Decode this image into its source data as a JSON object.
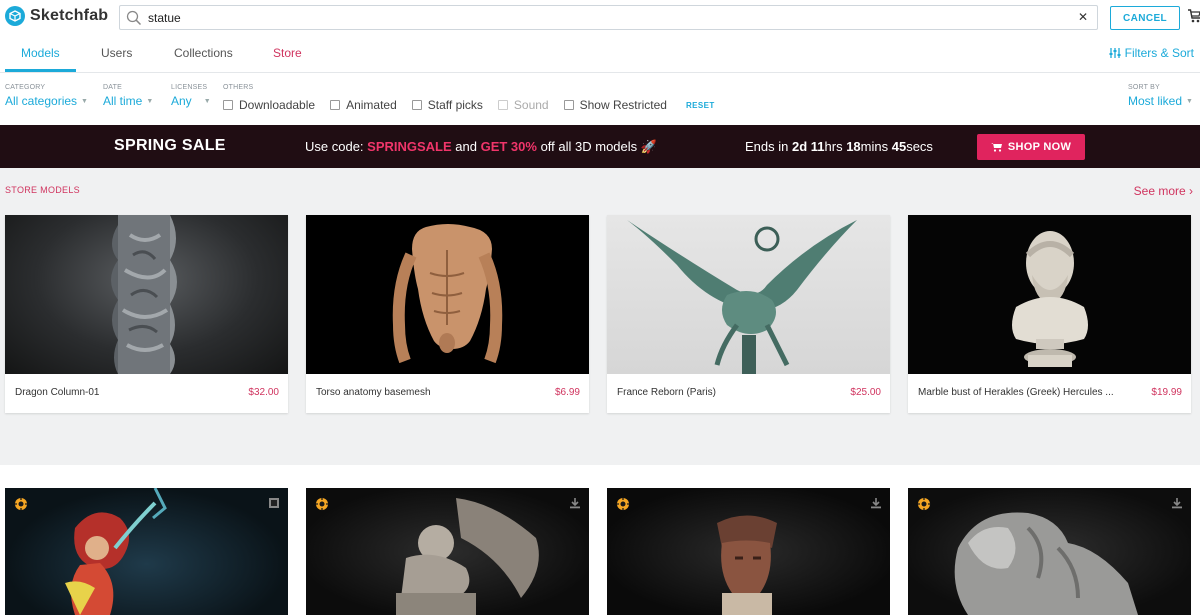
{
  "header": {
    "logo_text": "Sketchfab",
    "search_value": "statue",
    "cancel_label": "CANCEL"
  },
  "tabs": [
    {
      "label": "Models",
      "active": true
    },
    {
      "label": "Users",
      "active": false
    },
    {
      "label": "Collections",
      "active": false
    },
    {
      "label": "Store",
      "active": false
    }
  ],
  "filters_sort_label": "Filters & Sort",
  "filters": {
    "category": {
      "label": "CATEGORY",
      "value": "All categories"
    },
    "date": {
      "label": "DATE",
      "value": "All time"
    },
    "licenses": {
      "label": "LICENSES",
      "value": "Any"
    },
    "others_label": "OTHERS",
    "checks": [
      "Downloadable",
      "Animated",
      "Staff picks",
      "Sound",
      "Show Restricted"
    ],
    "reset_label": "RESET",
    "sort": {
      "label": "SORT BY",
      "value": "Most liked"
    }
  },
  "promo": {
    "title": "SPRING SALE",
    "code_prefix": "Use code: ",
    "code": "SPRINGSALE",
    "and": " and ",
    "discount": "GET 30%",
    "code_suffix": " off all 3D models",
    "ends_prefix": "Ends in ",
    "days": "2d",
    "hours_num": "11",
    "hours_unit": "hrs ",
    "mins_num": "18",
    "mins_unit": "mins ",
    "secs_num": "45",
    "secs_unit": "secs",
    "button_label": "SHOP NOW"
  },
  "store": {
    "title": "STORE MODELS",
    "see_more": "See more ›",
    "items": [
      {
        "title": "Dragon Column-01",
        "price": "$32.00"
      },
      {
        "title": "Torso anatomy basemesh",
        "price": "$6.99"
      },
      {
        "title": "France Reborn (Paris)",
        "price": "$25.00"
      },
      {
        "title": "Marble bust of Herakles (Greek) Hercules ...",
        "price": "$19.99"
      }
    ]
  },
  "colors": {
    "accent": "#1caad9",
    "store_pink": "#d0345f",
    "promo_bg": "#200d13",
    "shop_button": "#e0245e"
  }
}
